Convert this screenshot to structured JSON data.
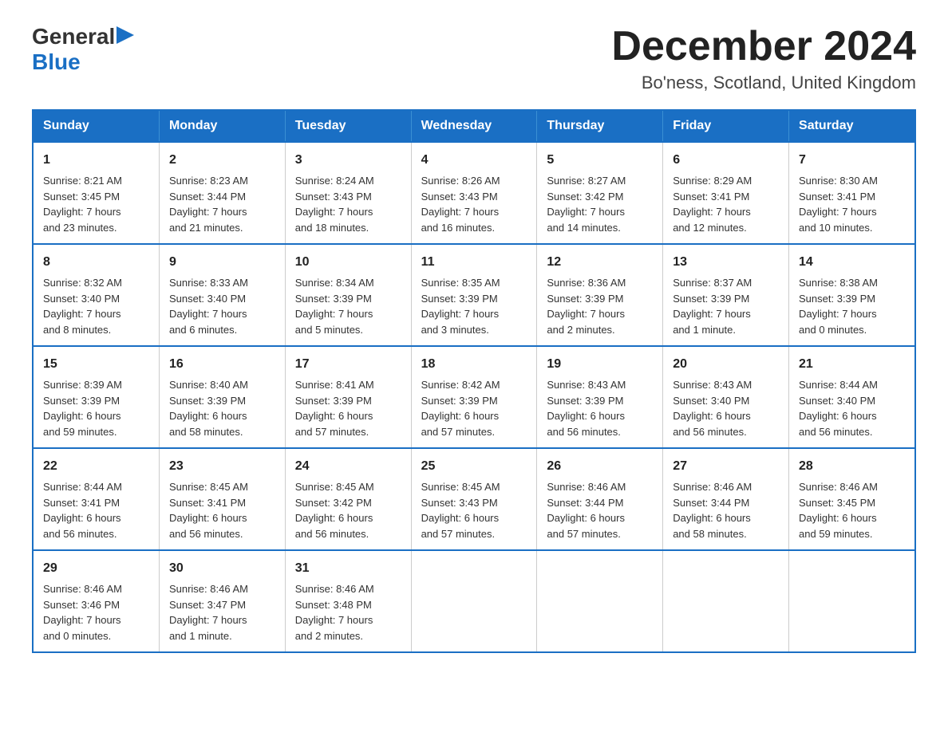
{
  "logo": {
    "general": "General",
    "blue": "Blue",
    "arrow": "▶"
  },
  "title": {
    "month_year": "December 2024",
    "location": "Bo'ness, Scotland, United Kingdom"
  },
  "calendar": {
    "headers": [
      "Sunday",
      "Monday",
      "Tuesday",
      "Wednesday",
      "Thursday",
      "Friday",
      "Saturday"
    ],
    "weeks": [
      [
        {
          "day": "1",
          "info": "Sunrise: 8:21 AM\nSunset: 3:45 PM\nDaylight: 7 hours\nand 23 minutes."
        },
        {
          "day": "2",
          "info": "Sunrise: 8:23 AM\nSunset: 3:44 PM\nDaylight: 7 hours\nand 21 minutes."
        },
        {
          "day": "3",
          "info": "Sunrise: 8:24 AM\nSunset: 3:43 PM\nDaylight: 7 hours\nand 18 minutes."
        },
        {
          "day": "4",
          "info": "Sunrise: 8:26 AM\nSunset: 3:43 PM\nDaylight: 7 hours\nand 16 minutes."
        },
        {
          "day": "5",
          "info": "Sunrise: 8:27 AM\nSunset: 3:42 PM\nDaylight: 7 hours\nand 14 minutes."
        },
        {
          "day": "6",
          "info": "Sunrise: 8:29 AM\nSunset: 3:41 PM\nDaylight: 7 hours\nand 12 minutes."
        },
        {
          "day": "7",
          "info": "Sunrise: 8:30 AM\nSunset: 3:41 PM\nDaylight: 7 hours\nand 10 minutes."
        }
      ],
      [
        {
          "day": "8",
          "info": "Sunrise: 8:32 AM\nSunset: 3:40 PM\nDaylight: 7 hours\nand 8 minutes."
        },
        {
          "day": "9",
          "info": "Sunrise: 8:33 AM\nSunset: 3:40 PM\nDaylight: 7 hours\nand 6 minutes."
        },
        {
          "day": "10",
          "info": "Sunrise: 8:34 AM\nSunset: 3:39 PM\nDaylight: 7 hours\nand 5 minutes."
        },
        {
          "day": "11",
          "info": "Sunrise: 8:35 AM\nSunset: 3:39 PM\nDaylight: 7 hours\nand 3 minutes."
        },
        {
          "day": "12",
          "info": "Sunrise: 8:36 AM\nSunset: 3:39 PM\nDaylight: 7 hours\nand 2 minutes."
        },
        {
          "day": "13",
          "info": "Sunrise: 8:37 AM\nSunset: 3:39 PM\nDaylight: 7 hours\nand 1 minute."
        },
        {
          "day": "14",
          "info": "Sunrise: 8:38 AM\nSunset: 3:39 PM\nDaylight: 7 hours\nand 0 minutes."
        }
      ],
      [
        {
          "day": "15",
          "info": "Sunrise: 8:39 AM\nSunset: 3:39 PM\nDaylight: 6 hours\nand 59 minutes."
        },
        {
          "day": "16",
          "info": "Sunrise: 8:40 AM\nSunset: 3:39 PM\nDaylight: 6 hours\nand 58 minutes."
        },
        {
          "day": "17",
          "info": "Sunrise: 8:41 AM\nSunset: 3:39 PM\nDaylight: 6 hours\nand 57 minutes."
        },
        {
          "day": "18",
          "info": "Sunrise: 8:42 AM\nSunset: 3:39 PM\nDaylight: 6 hours\nand 57 minutes."
        },
        {
          "day": "19",
          "info": "Sunrise: 8:43 AM\nSunset: 3:39 PM\nDaylight: 6 hours\nand 56 minutes."
        },
        {
          "day": "20",
          "info": "Sunrise: 8:43 AM\nSunset: 3:40 PM\nDaylight: 6 hours\nand 56 minutes."
        },
        {
          "day": "21",
          "info": "Sunrise: 8:44 AM\nSunset: 3:40 PM\nDaylight: 6 hours\nand 56 minutes."
        }
      ],
      [
        {
          "day": "22",
          "info": "Sunrise: 8:44 AM\nSunset: 3:41 PM\nDaylight: 6 hours\nand 56 minutes."
        },
        {
          "day": "23",
          "info": "Sunrise: 8:45 AM\nSunset: 3:41 PM\nDaylight: 6 hours\nand 56 minutes."
        },
        {
          "day": "24",
          "info": "Sunrise: 8:45 AM\nSunset: 3:42 PM\nDaylight: 6 hours\nand 56 minutes."
        },
        {
          "day": "25",
          "info": "Sunrise: 8:45 AM\nSunset: 3:43 PM\nDaylight: 6 hours\nand 57 minutes."
        },
        {
          "day": "26",
          "info": "Sunrise: 8:46 AM\nSunset: 3:44 PM\nDaylight: 6 hours\nand 57 minutes."
        },
        {
          "day": "27",
          "info": "Sunrise: 8:46 AM\nSunset: 3:44 PM\nDaylight: 6 hours\nand 58 minutes."
        },
        {
          "day": "28",
          "info": "Sunrise: 8:46 AM\nSunset: 3:45 PM\nDaylight: 6 hours\nand 59 minutes."
        }
      ],
      [
        {
          "day": "29",
          "info": "Sunrise: 8:46 AM\nSunset: 3:46 PM\nDaylight: 7 hours\nand 0 minutes."
        },
        {
          "day": "30",
          "info": "Sunrise: 8:46 AM\nSunset: 3:47 PM\nDaylight: 7 hours\nand 1 minute."
        },
        {
          "day": "31",
          "info": "Sunrise: 8:46 AM\nSunset: 3:48 PM\nDaylight: 7 hours\nand 2 minutes."
        },
        {
          "day": "",
          "info": ""
        },
        {
          "day": "",
          "info": ""
        },
        {
          "day": "",
          "info": ""
        },
        {
          "day": "",
          "info": ""
        }
      ]
    ]
  }
}
